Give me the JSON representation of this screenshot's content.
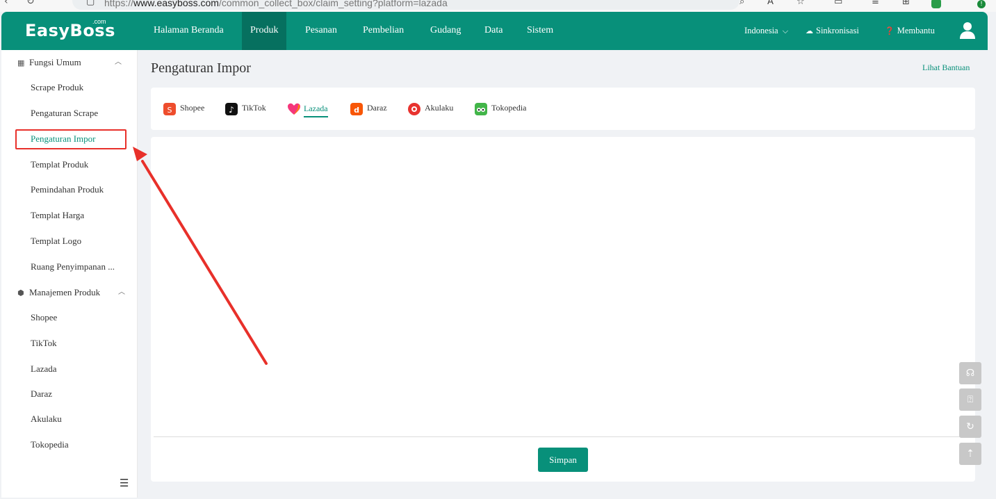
{
  "browser": {
    "url_prefix": "https://",
    "url_host": "www.easyboss.com",
    "url_path": "/common_collect_box/claim_setting?platform=lazada"
  },
  "topnav": {
    "logo": "EasyBoss",
    "logo_sup": ".com",
    "items": [
      "Halaman Beranda",
      "Produk",
      "Pesanan",
      "Pembelian",
      "Gudang",
      "Data",
      "Sistem"
    ],
    "active_item": "Produk",
    "region": "Indonesia",
    "sync": "Sinkronisasi",
    "help": "Membantu"
  },
  "sidebar": {
    "group1": "Fungsi Umum",
    "group1_items": [
      "Scrape Produk",
      "Pengaturan Scrape",
      "Pengaturan Impor",
      "Templat Produk",
      "Pemindahan Produk",
      "Templat Harga",
      "Templat Logo",
      "Ruang Penyimpanan ..."
    ],
    "active_item": "Pengaturan Impor",
    "group2": "Manajemen Produk",
    "group2_items": [
      "Shopee",
      "TikTok",
      "Lazada",
      "Daraz",
      "Akulaku",
      "Tokopedia"
    ]
  },
  "main": {
    "title": "Pengaturan Impor",
    "help_link": "Lihat Bantuan",
    "tabs": [
      "Shopee",
      "TikTok",
      "Lazada",
      "Daraz",
      "Akulaku",
      "Tokopedia"
    ],
    "active_tab": "Lazada",
    "save_button": "Simpan"
  },
  "icons": {
    "sidebar_group1": "grid-icon",
    "sidebar_group2": "cube-icon",
    "sync": "cloud-upload-icon",
    "help": "question-circle-icon",
    "user": "user-icon",
    "float_buttons": [
      "headset-icon",
      "feedback-icon",
      "refresh-icon",
      "back-to-top-icon"
    ]
  },
  "colors": {
    "brand": "#08907a",
    "brand_dark": "#06705f",
    "annotation": "#e8302a"
  }
}
